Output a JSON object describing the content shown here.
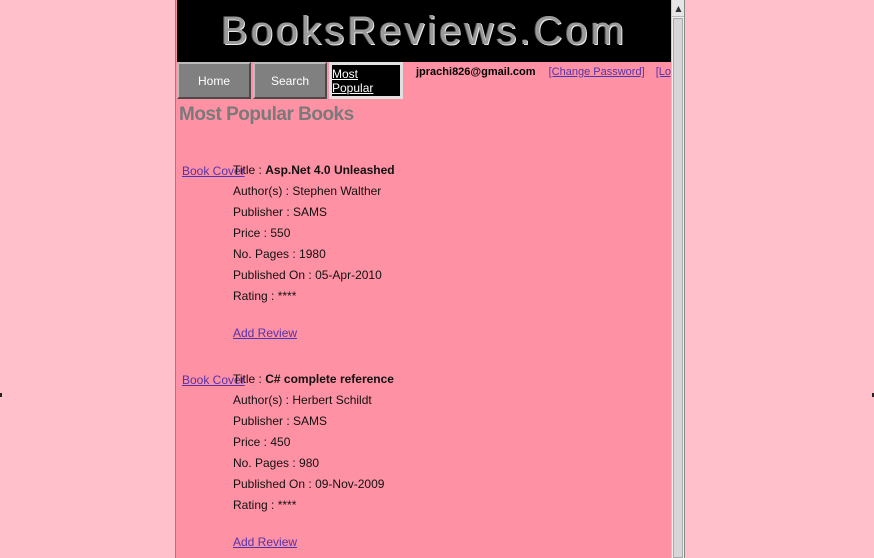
{
  "site": {
    "title": "BooksReviews.Com"
  },
  "nav": {
    "home_label": "Home",
    "search_label": "Search",
    "popular_label": "Most Popular"
  },
  "user": {
    "email": "jprachi826@gmail.com",
    "change_password_label": "[Change Password]",
    "logout_label": "[Logout]"
  },
  "section_title": "Most Popular Books",
  "books": [
    {
      "cover_link": "Book Cover",
      "title_label": "Title :",
      "title": "Asp.Net 4.0 Unleashed",
      "authors_label": "Author(s) :",
      "authors": "Stephen Walther",
      "publisher_label": "Publisher :",
      "publisher": "SAMS",
      "price_label": "Price :",
      "price": "550",
      "pages_label": "No. Pages :",
      "pages": "1980",
      "published_label": "Published On :",
      "published": "05-Apr-2010",
      "rating_label": "Rating :",
      "rating": "****",
      "add_review": "Add Review"
    },
    {
      "cover_link": "Book Cover",
      "title_label": "Title :",
      "title": "C# complete reference",
      "authors_label": "Author(s) :",
      "authors": "Herbert Schildt",
      "publisher_label": "Publisher :",
      "publisher": "SAMS",
      "price_label": "Price :",
      "price": "450",
      "pages_label": "No. Pages :",
      "pages": "980",
      "published_label": "Published On :",
      "published": "09-Nov-2009",
      "rating_label": "Rating :",
      "rating": "****",
      "add_review": "Add Review"
    }
  ],
  "colors": {
    "outer_background": "#ffc0cb",
    "page_background": "#ff91a4",
    "banner_background": "#000000",
    "link": "#5533aa"
  },
  "icons": {
    "scroll_up": "triangle-up-icon"
  }
}
